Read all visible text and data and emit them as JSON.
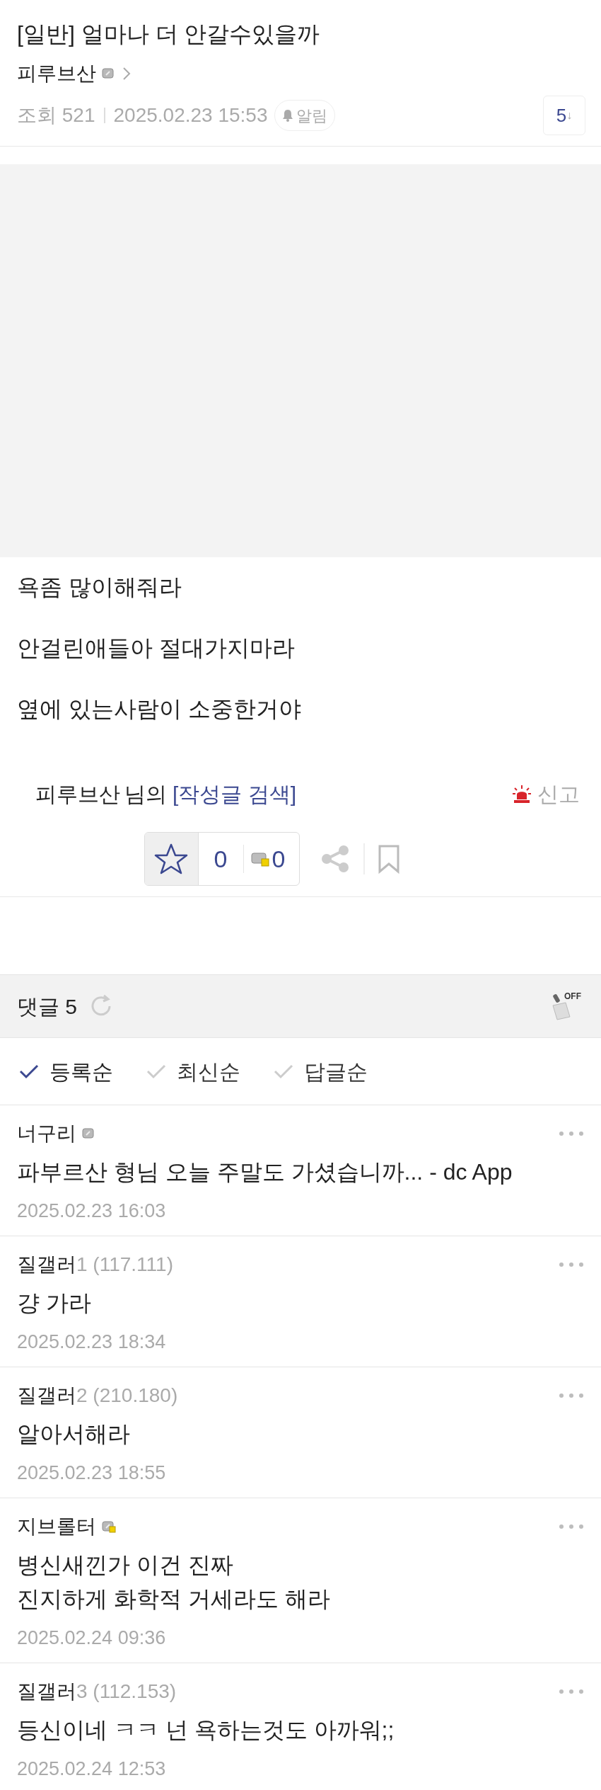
{
  "post": {
    "title": "[일반] 얼마나 더 안갈수있을까",
    "author": "피루브산",
    "author_badge": {
      "kind": "fixed"
    },
    "views": "조회 521",
    "date": "2025.02.23 15:53",
    "alarm": "알림",
    "comment_jump": "5",
    "comment_jump_arrow": "↓"
  },
  "body": {
    "kind": "image_then_text",
    "lines": [
      "욕좀 많이해줘라",
      "안걸린애들아 절대가지마라",
      "옆에 있는사람이 소중한거야"
    ]
  },
  "author_search": {
    "name": "피루브산",
    "suffix": "님의",
    "link": "[작성글 검색]",
    "report": "신고"
  },
  "actions": {
    "recommend": "0",
    "fixed_recommend": "0"
  },
  "comments_header": {
    "label": "댓글 5",
    "filter_label": "OFF"
  },
  "sort_options": [
    {
      "label": "등록순",
      "selected": true
    },
    {
      "label": "최신순",
      "selected": false
    },
    {
      "label": "답글순",
      "selected": false
    }
  ],
  "comments": [
    {
      "name": "너구리",
      "badge": {
        "kind": "fixed"
      },
      "text": [
        "파부르산 형님 오늘 주말도 가셨습니까... - dc App"
      ],
      "date": "2025.02.23 16:03"
    },
    {
      "name": "질갤러",
      "extra": "1 (117.111)",
      "text": [
        "걍 가라"
      ],
      "date": "2025.02.23 18:34"
    },
    {
      "name": "질갤러",
      "extra": "2 (210.180)",
      "text": [
        "알아서해라"
      ],
      "date": "2025.02.23 18:55"
    },
    {
      "name": "지브롤터",
      "badge": {
        "kind": "half_fixed"
      },
      "text": [
        "병신새낀가 이건 진짜",
        "진지하게 화학적 거세라도 해라"
      ],
      "date": "2025.02.24 09:36"
    },
    {
      "name": "질갤러",
      "extra": "3 (112.153)",
      "text": [
        "등신이네 ㅋㅋ 넌 욕하는것도 아까워;;"
      ],
      "date": "2025.02.24 12:53"
    }
  ]
}
